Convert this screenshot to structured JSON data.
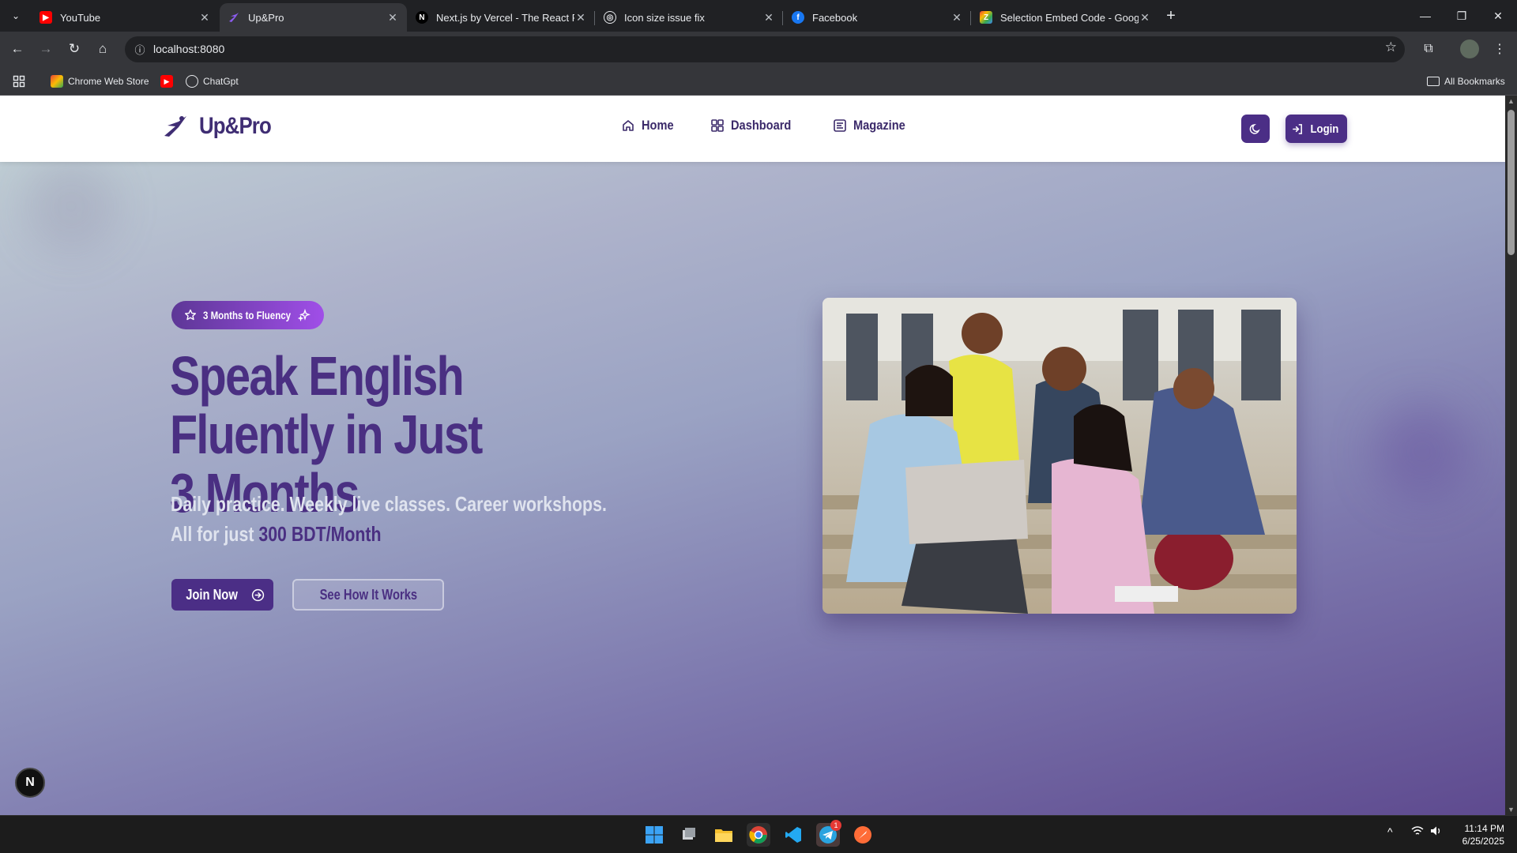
{
  "browser": {
    "tabs": [
      {
        "title": "YouTube",
        "icon": "youtube-icon",
        "active": false
      },
      {
        "title": "Up&Pro",
        "icon": "upandpro-icon",
        "active": true
      },
      {
        "title": "Next.js by Vercel - The React Fra",
        "icon": "nextjs-icon",
        "active": false
      },
      {
        "title": "Icon size issue fix",
        "icon": "chatgpt-icon",
        "active": false
      },
      {
        "title": "Facebook",
        "icon": "facebook-icon",
        "active": false
      },
      {
        "title": "Selection Embed Code - Googl",
        "icon": "google-icon",
        "active": false
      }
    ],
    "url": "localhost:8080",
    "bookmarks": [
      {
        "label": "Chrome Web Store",
        "icon": "chrome-web-store-icon"
      },
      {
        "label": "",
        "icon": "youtube-icon"
      },
      {
        "label": "ChatGpt",
        "icon": "chatgpt-icon"
      }
    ],
    "all_bookmarks": "All Bookmarks"
  },
  "site": {
    "brand": "Up&Pro",
    "nav": [
      {
        "label": "Home",
        "icon": "home-icon"
      },
      {
        "label": "Dashboard",
        "icon": "dashboard-icon"
      },
      {
        "label": "Magazine",
        "icon": "magazine-icon"
      }
    ],
    "login_label": "Login",
    "colors": {
      "primary": "#4b2e86",
      "accent": "#a04ee8",
      "headline": "#4a2f82"
    }
  },
  "hero": {
    "badge": "3 Months to Fluency",
    "headline_line1": "Speak English Fluently in Just",
    "headline_line2": "3 Months",
    "sub_line1": "Daily practice. Weekly live classes. Career workshops.",
    "sub_line2_prefix": "All for just ",
    "sub_line2_price": "300 BDT/Month",
    "join_label": "Join Now",
    "how_label": "See How It Works"
  },
  "dev_indicator": "N",
  "taskbar": {
    "time": "11:14 PM",
    "date": "6/25/2025",
    "telegram_badge": "1"
  }
}
